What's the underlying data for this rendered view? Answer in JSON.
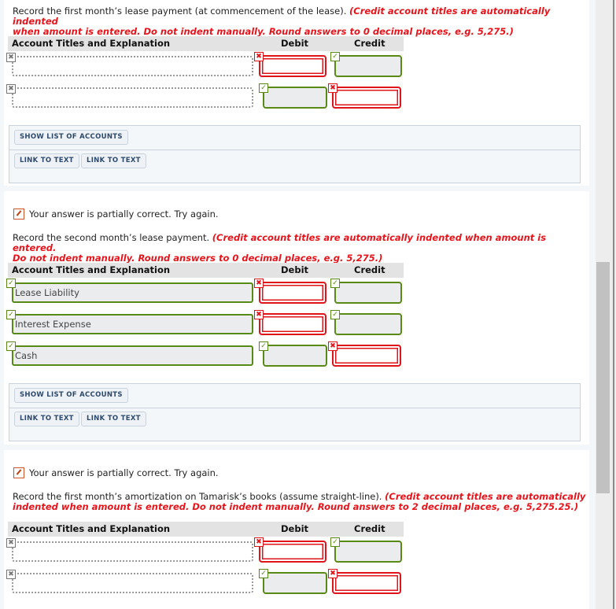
{
  "columns": {
    "account": "Account Titles and Explanation",
    "debit": "Debit",
    "credit": "Credit"
  },
  "buttons": {
    "show_accounts": "SHOW LIST OF ACCOUNTS",
    "link_to_text": "LINK TO TEXT"
  },
  "status_glyphs": {
    "none": "✖",
    "incorrect": "✖",
    "correct": "✓"
  },
  "questions": [
    {
      "feedback": null,
      "prompt": "Record the first month’s lease payment (at commencement of the lease).",
      "hint_line1": "(Credit account titles are automatically indented",
      "hint_line2": "when amount is entered. Do not indent manually. Round answers to 0 decimal places, e.g. 5,275.)",
      "rows": [
        {
          "account": "",
          "account_status": "none",
          "debit": "",
          "debit_status": "incorrect",
          "credit": "",
          "credit_status": "correct",
          "indented": false
        },
        {
          "account": "",
          "account_status": "none",
          "debit": "",
          "debit_status": "correct",
          "credit": "",
          "credit_status": "incorrect",
          "indented": true
        }
      ]
    },
    {
      "feedback": "Your answer is partially correct.  Try again.",
      "prompt": "Record the second month’s lease payment.",
      "hint_line1": "(Credit account titles are automatically indented when amount is entered.",
      "hint_line2": "Do not indent manually. Round answers to 0 decimal places, e.g. 5,275.)",
      "rows": [
        {
          "account": "Lease Liability",
          "account_status": "correct",
          "debit": "",
          "debit_status": "incorrect",
          "credit": "",
          "credit_status": "correct",
          "indented": false
        },
        {
          "account": "Interest Expense",
          "account_status": "correct",
          "debit": "",
          "debit_status": "incorrect",
          "credit": "",
          "credit_status": "correct",
          "indented": false
        },
        {
          "account": "Cash",
          "account_status": "correct",
          "debit": "",
          "debit_status": "correct",
          "credit": "",
          "credit_status": "incorrect",
          "indented": true
        }
      ]
    },
    {
      "feedback": "Your answer is partially correct.  Try again.",
      "prompt": "Record the first month’s amortization on Tamarisk’s books (assume straight-line).",
      "hint_line1": "(Credit account titles are automatically",
      "hint_line2": "indented when amount is entered. Do not indent manually. Round answers to 2 decimal places, e.g. 5,275.25.)",
      "rows": [
        {
          "account": "",
          "account_status": "none",
          "debit": "",
          "debit_status": "incorrect",
          "credit": "",
          "credit_status": "correct",
          "indented": false
        },
        {
          "account": "",
          "account_status": "none",
          "debit": "",
          "debit_status": "correct",
          "credit": "",
          "credit_status": "incorrect",
          "indented": true
        }
      ]
    }
  ],
  "scrollbar": {
    "visible_fraction": 0.38,
    "position_fraction": 0.43
  }
}
